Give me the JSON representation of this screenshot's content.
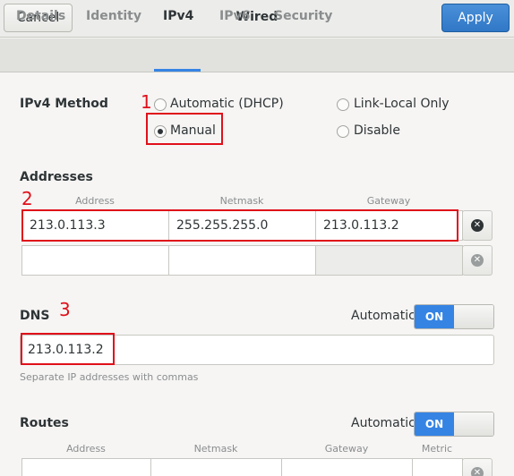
{
  "header": {
    "cancel_label": "Cancel",
    "title": "Wired",
    "apply_label": "Apply"
  },
  "tabs": [
    "Details",
    "Identity",
    "IPv4",
    "IPv6",
    "Security"
  ],
  "ipv4_method": {
    "label": "IPv4 Method",
    "options": {
      "automatic_dhcp": "Automatic (DHCP)",
      "link_local_only": "Link-Local Only",
      "manual": "Manual",
      "disable": "Disable"
    },
    "selected": "manual"
  },
  "addresses": {
    "label": "Addresses",
    "columns": [
      "Address",
      "Netmask",
      "Gateway"
    ],
    "rows": [
      {
        "address": "213.0.113.3",
        "netmask": "255.255.255.0",
        "gateway": "213.0.113.2"
      },
      {
        "address": "",
        "netmask": "",
        "gateway": ""
      }
    ]
  },
  "dns": {
    "label": "DNS",
    "automatic_label": "Automatic",
    "switch_label": "ON",
    "value": "213.0.113.2",
    "hint": "Separate IP addresses with commas"
  },
  "routes": {
    "label": "Routes",
    "automatic_label": "Automatic",
    "switch_label": "ON",
    "columns": [
      "Address",
      "Netmask",
      "Gateway",
      "Metric"
    ]
  },
  "annotations": [
    "1",
    "2",
    "3"
  ],
  "colors": {
    "accent": "#3584e4",
    "annotation_red": "#e0101a"
  }
}
